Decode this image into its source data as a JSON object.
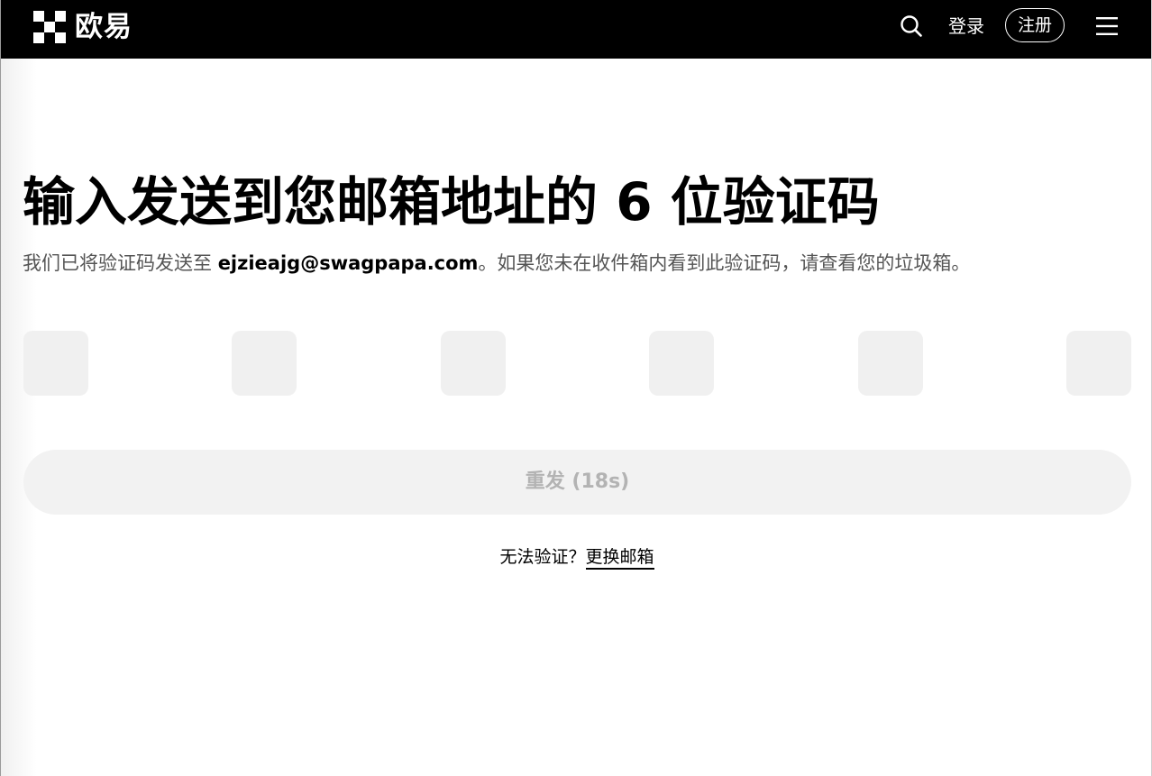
{
  "header": {
    "logo_text": "欧易",
    "login_label": "登录",
    "register_label": "注册",
    "search_icon": "search-icon",
    "menu_icon": "hamburger-menu-icon"
  },
  "main": {
    "title": "输入发送到您邮箱地址的 6 位验证码",
    "subtitle_prefix": "我们已将验证码发送至 ",
    "email": "ejzieajg@swagpapa.com",
    "subtitle_suffix": "。如果您未在收件箱内看到此验证码，请查看您的垃圾箱。",
    "code_digits": [
      "",
      "",
      "",
      "",
      "",
      ""
    ],
    "resend_label": "重发 (18s)",
    "help_text": "无法验证？",
    "change_email_label": "更换邮箱"
  },
  "colors": {
    "header_bg": "#000000",
    "input_bg": "#f0f0f0",
    "button_bg": "#f2f2f2",
    "button_text_disabled": "#b3b3b3",
    "subtitle_text": "#555555"
  }
}
